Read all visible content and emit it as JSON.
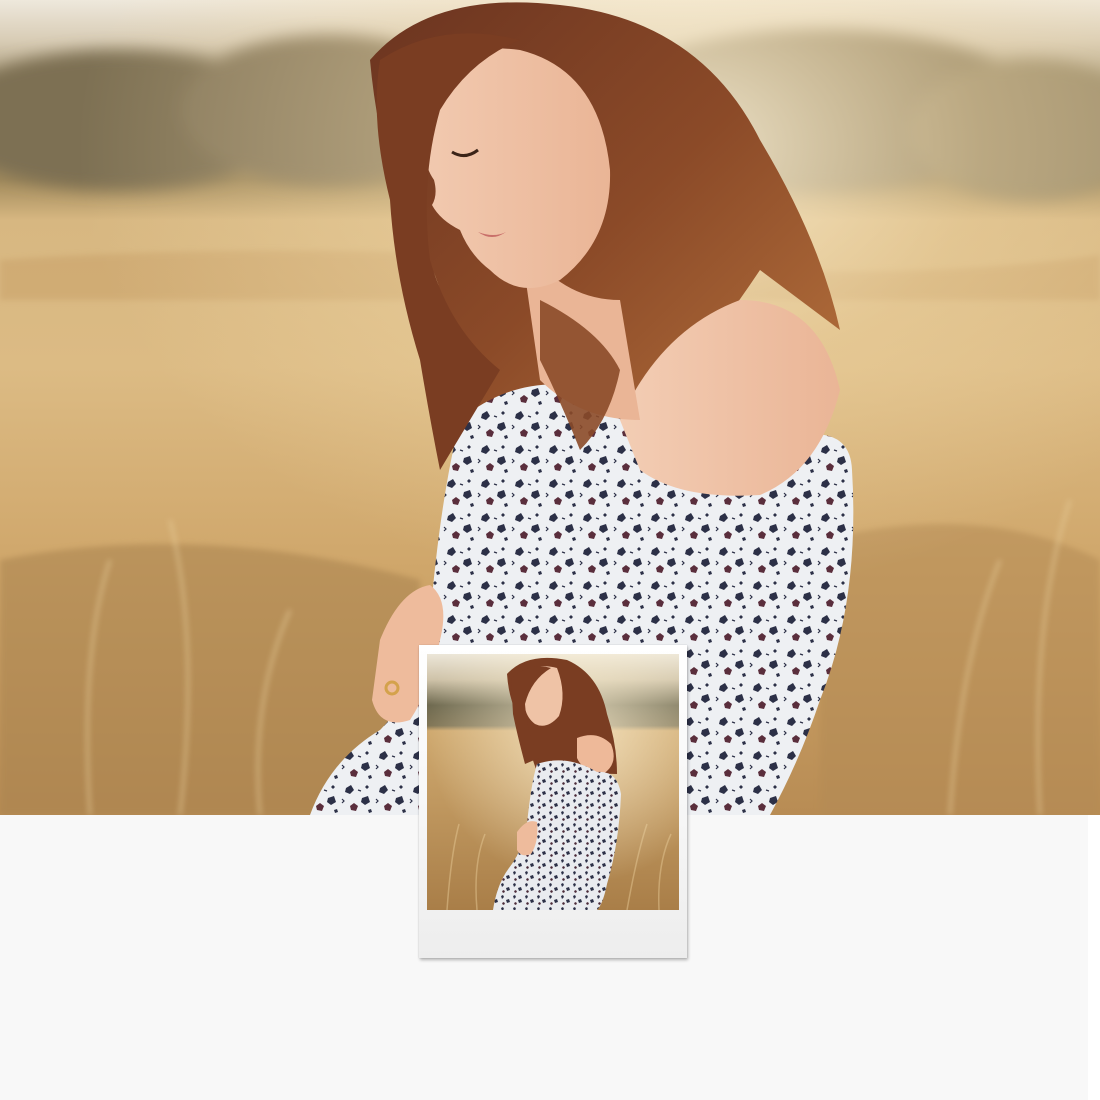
{
  "scene": {
    "subject": "pregnant-woman-in-floral-dress",
    "setting": "golden-grass-field-at-sunset"
  },
  "palette": {
    "sky": "#e9e3d6",
    "treeline": "#8c7e5f",
    "field_light": "#d9b77e",
    "field_mid": "#c89e62",
    "field_dark": "#a17745",
    "hair": "#7a3d22",
    "hair_highlight": "#b9713f",
    "skin": "#f1c7ad",
    "skin_shadow": "#d99a7d",
    "dress": "#eef0f3",
    "dress_print": "#2c3047",
    "dress_print_alt": "#5a2e3c",
    "panel": "#f8f8f8",
    "polaroid_frame": "#f5f5f5"
  },
  "icons": {
    "photo_frame": "polaroid-frame-icon"
  }
}
